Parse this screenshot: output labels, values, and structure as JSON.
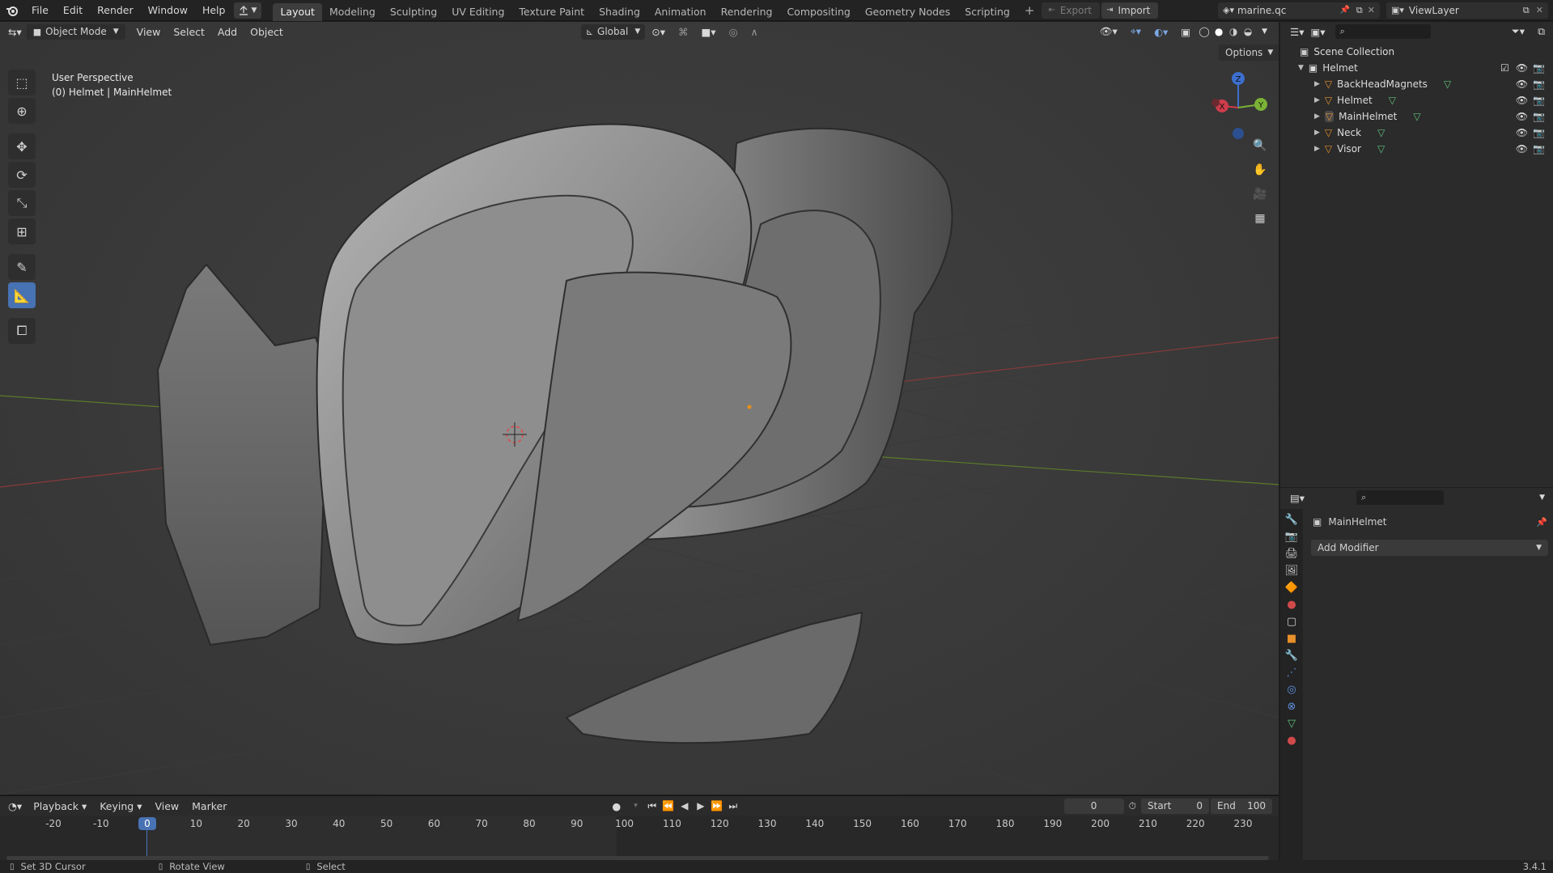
{
  "topbar": {
    "menus": [
      "File",
      "Edit",
      "Render",
      "Window",
      "Help"
    ],
    "workspaces": [
      "Layout",
      "Modeling",
      "Sculpting",
      "UV Editing",
      "Texture Paint",
      "Shading",
      "Animation",
      "Rendering",
      "Compositing",
      "Geometry Nodes",
      "Scripting"
    ],
    "active_workspace": "Layout",
    "add_workspace": "+",
    "export_label": "Export",
    "import_label": "Import",
    "scene_name": "marine.qc",
    "view_layer": "ViewLayer"
  },
  "viewport": {
    "mode": "Object Mode",
    "menus": [
      "View",
      "Select",
      "Add",
      "Object"
    ],
    "orientation": "Global",
    "options_label": "Options",
    "overlay_line1": "User Perspective",
    "overlay_line2": "(0) Helmet | MainHelmet",
    "gizmo_x": "X",
    "gizmo_y": "Y",
    "gizmo_z": "Z"
  },
  "outliner": {
    "root": "Scene Collection",
    "collection": "Helmet",
    "objects": [
      "BackHeadMagnets",
      "Helmet",
      "MainHelmet",
      "Neck",
      "Visor"
    ]
  },
  "properties": {
    "object_name": "MainHelmet",
    "add_modifier": "Add Modifier"
  },
  "timeline": {
    "menus": [
      "Playback",
      "Keying",
      "View",
      "Marker"
    ],
    "current_frame": "0",
    "start_label": "Start",
    "start_value": "0",
    "end_label": "End",
    "end_value": "100",
    "ticks": [
      "-20",
      "-10",
      "0",
      "10",
      "20",
      "30",
      "40",
      "50",
      "60",
      "70",
      "80",
      "90",
      "100",
      "110",
      "120",
      "130",
      "140",
      "150",
      "160",
      "170",
      "180",
      "190",
      "200",
      "210",
      "220",
      "230"
    ]
  },
  "statusbar": {
    "left": "Set 3D Cursor",
    "middle": "Rotate View",
    "right": "Select",
    "version": "3.4.1"
  }
}
